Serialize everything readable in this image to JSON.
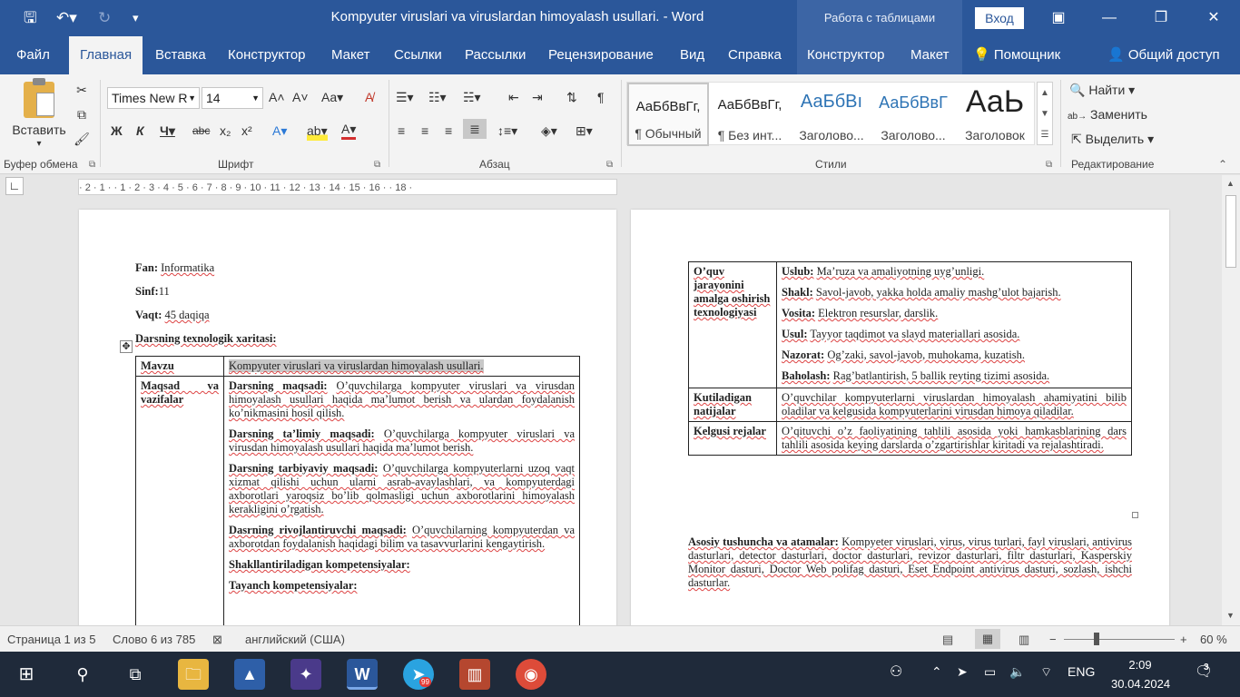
{
  "window": {
    "title": "Kompyuter viruslari va viruslardan himoyalash usullari.  -  Word",
    "context_tab": "Работа с таблицами",
    "login_button": "Вход"
  },
  "menu": {
    "tabs": [
      "Файл",
      "Главная",
      "Вставка",
      "Конструктор",
      "Макет",
      "Ссылки",
      "Рассылки",
      "Рецензирование",
      "Вид",
      "Справка",
      "Конструктор",
      "Макет"
    ],
    "help": "Помощник",
    "share": "Общий доступ"
  },
  "ribbon": {
    "paste_label": "Вставить",
    "font_name": "Times New R",
    "font_size": "14",
    "groups": {
      "clipboard": "Буфер обмена",
      "font": "Шрифт",
      "paragraph": "Абзац",
      "styles": "Стили",
      "editing": "Редактирование"
    },
    "styles": [
      {
        "preview": "АаБбВвГг,",
        "name": "¶ Обычный"
      },
      {
        "preview": "АаБбВвГг,",
        "name": "¶ Без инт..."
      },
      {
        "preview": "АаБбВı",
        "name": "Заголово..."
      },
      {
        "preview": "АаБбВвГ",
        "name": "Заголово..."
      },
      {
        "preview": "АаЬ",
        "name": "Заголовок"
      }
    ],
    "find": "Найти",
    "replace": "Заменить",
    "select": "Выделить"
  },
  "ruler": {
    "marks": "· 2 · 1 ·   · 1 · 2 · 3 · 4 · 5 · 6 · 7 · 8 · 9 · 10 · 11 · 12 · 13 · 14 · 15 · 16 ·   · 18 ·"
  },
  "page1": {
    "fan_label": "Fan:",
    "fan_value": "Informatika",
    "sinf_label": "Sinf:",
    "sinf_value": "11",
    "vaqt_label": "Vaqt:",
    "vaqt_value": "45 daqiqa",
    "map_title": "Darsning texnologik xaritasi:",
    "mavzu_label": "Mavzu",
    "mavzu_value": "Kompyuter viruslari va viruslardan himoyalash usullari.",
    "maqsad_label": "Maqsad va vazifalar",
    "p1_head": "Darsning maqsadi:",
    "p1_text": "O’quvchilarga kompyuter viruslari va virusdan himoyalash usullari haqida ma’lumot berish va ulardan foydalanish ko’nikmasini hosil qilish.",
    "p2_head": "Darsning ta’limiy maqsadi:",
    "p2_text": "O’quvchilarga kompyuter viruslari va virusdan himoyalash usullari haqida ma’lumot berish.",
    "p3_head": "Darsning tarbiyaviy maqsadi:",
    "p3_text": "O’quvchilarga kompyuterlarni uzoq vaqt xizmat qilishi uchun ularni asrab-avaylashlari, va kompyuterdagi axborotlari yaroqsiz bo’lib qolmasligi uchun axborotlarini himoyalash kerakligini o’rgatish.",
    "p4_head": "Dasrning rivojlantiruvchi maqsadi:",
    "p4_text": "O’quvchilarning kompyuterdan va axborotdan foydalanish haqidagi bilim va tasavvurlarini kengaytirish.",
    "p5_head": "Shakllantiriladigan kompetensiyalar:",
    "p6_head": "Tayanch kompetensiyalar:"
  },
  "page2": {
    "row1_label": "O’quv jarayonini amalga oshirish texnologiyasi",
    "items": [
      {
        "head": "Uslub:",
        "text": "Ma’ruza va amaliyotning uyg’unligi."
      },
      {
        "head": "Shakl:",
        "text": "Savol-javob, yakka holda amaliy mashg’ulot bajarish."
      },
      {
        "head": "Vosita:",
        "text": "Elektron resurslar, darslik."
      },
      {
        "head": "Usul:",
        "text": "Tayyor taqdimot va slayd materiallari asosida."
      },
      {
        "head": "Nazorat:",
        "text": "Og’zaki, savol-javob, muhokama, kuzatish."
      },
      {
        "head": "Baholash:",
        "text": "Rag’batlantirish, 5 ballik reyting tizimi asosida."
      }
    ],
    "row2_label": "Kutiladigan natijalar",
    "row2_text": "O’quvchilar kompyuterlarni viruslardan himoyalash ahamiyatini bilib oladilar va kelgusida kompyuterlarini virusdan himoya qiladilar.",
    "row3_label": "Kelgusi rejalar",
    "row3_text": "O’qituvchi o’z faoliyatining tahlili asosida yoki hamkasblarining dars tahlili asosida keying darslarda o’zgartirishlar kiritadi va rejalashtiradi.",
    "terms_head": "Asosiy tushuncha va atamalar:",
    "terms_text": "Kompyeter viruslari, virus, virus turlari, fayl viruslari, antivirus dasturlari, detector dasturlari, doctor dasturlari, revizor dasturlari, filtr dasturlari, Kasperskiy Monitor dasturi, Doctor Web polifag dasturi, Eset Endpoint antivirus dasturi, sozlash, ishchi dasturlar."
  },
  "status": {
    "page": "Страница 1 из 5",
    "words": "Слово 6 из 785",
    "language": "английский (США)",
    "zoom": "60 %"
  },
  "taskbar": {
    "telegram_badge": "99",
    "lang": "ENG",
    "time": "2:09",
    "date": "30.04.2024",
    "notifications": "3"
  }
}
